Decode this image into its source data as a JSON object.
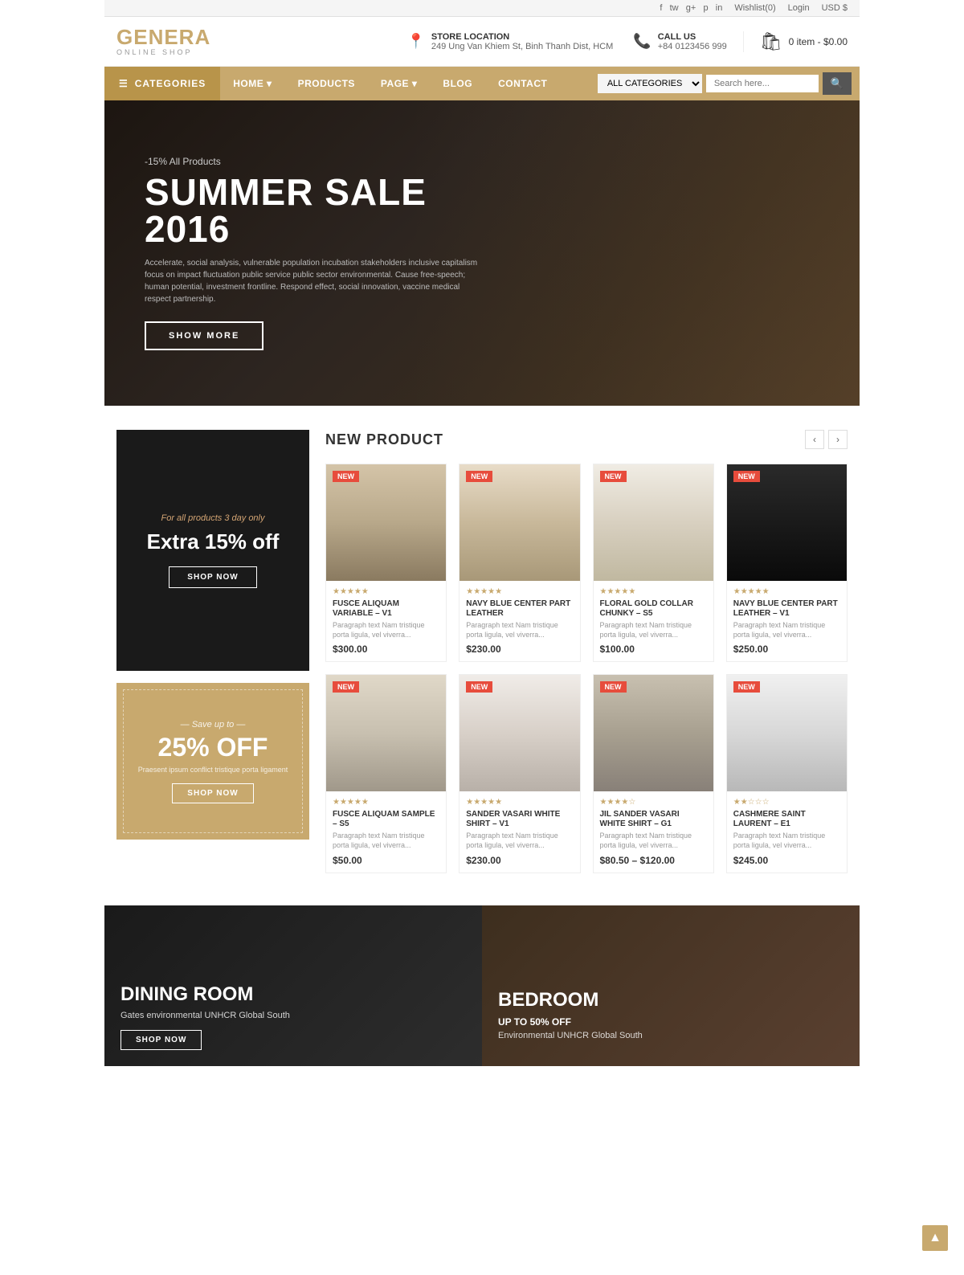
{
  "topbar": {
    "wishlist": "Wishlist(0)",
    "login": "Login",
    "currency": "USD $",
    "social": [
      "f",
      "tw",
      "g+",
      "p",
      "in"
    ]
  },
  "header": {
    "logo_main": "GENERA",
    "logo_sub": "ONLINE SHOP",
    "store_label": "STORE LOCATION",
    "store_address": "249 Ung Van Khiem St, Binh Thanh Dist, HCM",
    "call_label": "CALL US",
    "call_number": "+84 0123456 999",
    "cart_label": "0 item - $0.00"
  },
  "nav": {
    "categories": "CATEGORIES",
    "items": [
      {
        "label": "HOME",
        "has_arrow": true
      },
      {
        "label": "PRODUCTS",
        "has_arrow": false
      },
      {
        "label": "PAGE",
        "has_arrow": true
      },
      {
        "label": "BLOG",
        "has_arrow": false
      },
      {
        "label": "CONTACT",
        "has_arrow": false
      }
    ],
    "search_placeholder": "Search here...",
    "all_categories": "ALL CATEGORIES"
  },
  "hero": {
    "discount": "-15% All Products",
    "title": "SUMMER SALE 2016",
    "description": "Accelerate, social analysis, vulnerable population incubation stakeholders inclusive capitalism focus on impact fluctuation public service public sector environmental. Cause free-speech; human potential, investment frontline. Respond effect, social innovation, vaccine medical respect partnership.",
    "button": "SHOW MORE"
  },
  "sidebar_promo1": {
    "subtitle": "For all products 3 day only",
    "title": "Extra 15% off",
    "button": "SHOP NOW"
  },
  "sidebar_promo2": {
    "save_label": "— Save up to —",
    "title": "25% OFF",
    "description": "Praesent ipsum conflict tristique porta ligament",
    "button": "SHOP NOW"
  },
  "products": {
    "section_title": "NEW PRODUCT",
    "items": [
      {
        "badge": "NEW",
        "name": "FUSCE ALIQUAM VARIABLE – V1",
        "desc": "Paragraph text Nam tristique porta ligula, vel viverra...",
        "price": "$300.00",
        "stars": "★★★★★",
        "bg": "furniture-1"
      },
      {
        "badge": "NEW",
        "name": "NAVY BLUE CENTER PART LEATHER",
        "desc": "Paragraph text Nam tristique porta ligula, vel viverra...",
        "price": "$230.00",
        "stars": "★★★★★",
        "bg": "furniture-2"
      },
      {
        "badge": "NEW",
        "name": "FLORAL GOLD COLLAR CHUNKY – S5",
        "desc": "Paragraph text Nam tristique porta ligula, vel viverra...",
        "price": "$100.00",
        "stars": "★★★★★",
        "bg": "furniture-3"
      },
      {
        "badge": "NEW",
        "name": "NAVY BLUE CENTER PART LEATHER – V1",
        "desc": "Paragraph text Nam tristique porta ligula, vel viverra...",
        "price": "$250.00",
        "stars": "★★★★★",
        "bg": "furniture-4"
      },
      {
        "badge": "NEW",
        "name": "FUSCE ALIQUAM SAMPLE – S5",
        "desc": "Paragraph text Nam tristique porta ligula, vel viverra...",
        "price": "$50.00",
        "stars": "★★★★★",
        "bg": "furniture-5"
      },
      {
        "badge": "NEW",
        "name": "SANDER VASARI WHITE SHIRT – V1",
        "desc": "Paragraph text Nam tristique porta ligula, vel viverra...",
        "price": "$230.00",
        "stars": "★★★★★",
        "bg": "furniture-6"
      },
      {
        "badge": "NEW",
        "name": "JIL SANDER VASARI WHITE SHIRT – G1",
        "desc": "Paragraph text Nam tristique porta ligula, vel viverra...",
        "price": "$80.50 – $120.00",
        "stars": "★★★★☆",
        "bg": "furniture-7"
      },
      {
        "badge": "NEW",
        "name": "CASHMERE SAINT LAURENT – E1",
        "desc": "Paragraph text Nam tristique porta ligula, vel viverra...",
        "price": "$245.00",
        "stars": "★★☆☆☆",
        "bg": "furniture-8"
      }
    ]
  },
  "banners": [
    {
      "title": "DINING ROOM",
      "subtitle": "Gates environmental UNHCR Global South",
      "button": "SHOP NOW",
      "badge": ""
    },
    {
      "title": "BEDROOM",
      "badge": "UP TO 50% OFF",
      "subtitle": "Environmental UNHCR Global South",
      "button": ""
    }
  ]
}
